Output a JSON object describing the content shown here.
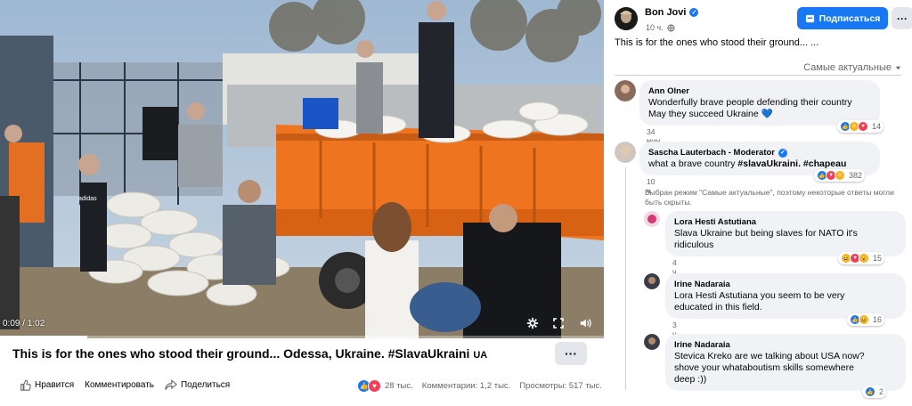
{
  "video": {
    "time": "0:09 / 1:02",
    "progress": 0.145,
    "bag_label": "adidas"
  },
  "caption": {
    "text": "This is for the ones who stood their ground... Odessa, Ukraine. #SlavaUkraini",
    "flag": "UA",
    "more": "···"
  },
  "actions": {
    "like": "Нравится",
    "comment": "Комментировать",
    "share": "Поделиться"
  },
  "stats": {
    "reactions": "28 тыс.",
    "comments": "Комментарии: 1,2 тыс.",
    "views": "Просмотры: 517 тыс."
  },
  "post": {
    "page_name": "Bon Jovi",
    "time": "10 ч.",
    "subscribe": "Подписаться",
    "more": "···",
    "text": "This is for the ones who stood their ground... ...",
    "sort": "Самые актуальные"
  },
  "note": "Выбран режим \"Самые актуальные\", поэтому некоторые ответы могли быть скрыты.",
  "comments": [
    {
      "name": "Ann Olner",
      "lines": [
        "Wonderfully brave people defending their country",
        "May they succeed Ukraine 💙"
      ],
      "time": "34 мин.",
      "reactions": "14"
    },
    {
      "name": "Sascha Lauterbach - Moderator",
      "text": "what a brave country ",
      "tags": "#slavaUkraini. #chapeau",
      "time": "10 ч.",
      "reactions": "382"
    },
    {
      "name": "Lora Hesti Astutiana",
      "lines": [
        "Slava Ukraine but being slaves for NATO it's",
        "ridiculous"
      ],
      "time": "4 ч.",
      "reactions": "15"
    },
    {
      "name": "Irine Nadaraia",
      "lines": [
        "Lora Hesti Astutiana you seem to be very",
        "educated in this field."
      ],
      "time": "3 ч.",
      "reactions": "16"
    },
    {
      "name": "Irine Nadaraia",
      "lines": [
        "Stevica Kreko are we talking about USA now?",
        "shove your whataboutism skills somewhere",
        "deep :))"
      ],
      "time": "",
      "reactions": "2"
    }
  ],
  "colors": {
    "accent": "#1877f2",
    "like": "#1877f2",
    "love": "#f33e58",
    "haha": "#f7b125"
  }
}
